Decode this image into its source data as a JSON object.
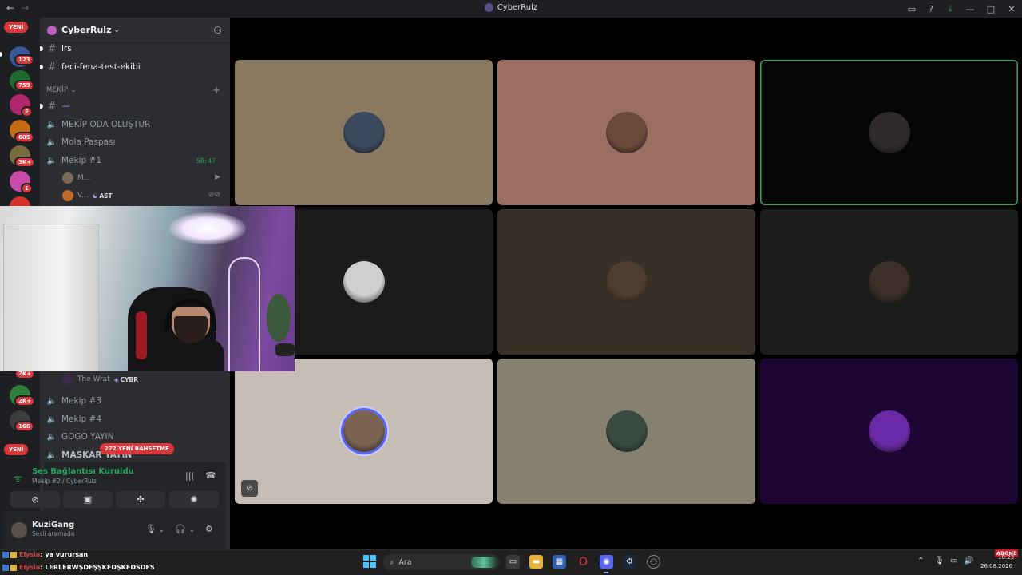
{
  "window": {
    "title": "CyberRulz",
    "nav_back": "←",
    "nav_forward": "→",
    "icons": [
      "inbox-icon",
      "help-icon",
      "download-icon"
    ],
    "controls": {
      "minimize": "—",
      "maximize": "□",
      "close": "✕"
    }
  },
  "rail": {
    "new_top_label": "YENİ",
    "new_bottom_label": "YENİ",
    "servers": [
      {
        "badge": "123",
        "color": "#3b5998"
      },
      {
        "badge": "759",
        "color": "#1f6b2f"
      },
      {
        "badge": "2",
        "color": "#b0276e"
      },
      {
        "badge": "605",
        "color": "#c66a14"
      },
      {
        "badge": "3K+",
        "color": "#7a6a3f"
      },
      {
        "badge": "1",
        "color": "#c94aa8"
      },
      {
        "badge": "",
        "color": "#d4312a"
      },
      {
        "badge": "2K+",
        "color": "#555"
      },
      {
        "badge": "2K+",
        "color": "#2f7d3a"
      },
      {
        "badge": "166",
        "color": "#3d3d3d"
      }
    ]
  },
  "sidebar": {
    "server_name": "CyberRulz",
    "channels_top": [
      {
        "name": "lrs"
      },
      {
        "name": "feci-fena-test-ekibi"
      }
    ],
    "category": "MEKİP",
    "channels": [
      {
        "name": "—"
      },
      {
        "name": "MEKİP ODA OLUŞTUR"
      },
      {
        "name": "Mola Paspası"
      },
      {
        "name": "Mekip #1",
        "time": "58:47"
      }
    ],
    "voice_users": [
      {
        "name": "M..."
      },
      {
        "name": "V...",
        "tag": "AST"
      }
    ],
    "lower_user": {
      "name": "The Wrat",
      "tag": "CYBR"
    },
    "channels_lower": [
      {
        "name": "Mekip #3"
      },
      {
        "name": "Mekip #4"
      },
      {
        "name": "GOGO YAYIN"
      },
      {
        "name": "MASKAR YAYIN"
      }
    ],
    "mentions_label": "272 YENİ BAHSETME"
  },
  "voice_panel": {
    "status": "Ses Bağlantısı Kuruldu",
    "location": "Mekip #2 / CyberRulz"
  },
  "user_panel": {
    "name": "KuziGang",
    "status": "Sesli aramada"
  },
  "tiles": [
    {
      "bg": "#8b7a62",
      "avatar": "#3a4a5c"
    },
    {
      "bg": "#9a6e60",
      "avatar": "#6b4a3a"
    },
    {
      "bg": "#050505",
      "avatar": "#2e2b2a",
      "active": true
    },
    {
      "bg": "#1b1b1b",
      "avatar": "#cfcfcf"
    },
    {
      "bg": "#382f26",
      "avatar": "#4d3e2e"
    },
    {
      "bg": "#1a1d1c",
      "avatar": "#3b2f28"
    },
    {
      "bg": "#c6beb5",
      "avatar": "#7a6350",
      "ring": true
    },
    {
      "bg": "#86806f",
      "avatar": "#3a4a40"
    },
    {
      "bg": "#1d0633",
      "avatar": "#6a2aa8"
    }
  ],
  "chat_overlay": [
    {
      "user": "Elysia",
      "text": ": ya vurursan"
    },
    {
      "user": "Elysia",
      "text": ": LERLERWŞDFŞŞKFDŞKFDSDFS"
    }
  ],
  "taskbar": {
    "search_placeholder": "Ara",
    "tray_time": "10:23",
    "tray_date": "26.08.2026",
    "abone_label": "ABONE"
  }
}
